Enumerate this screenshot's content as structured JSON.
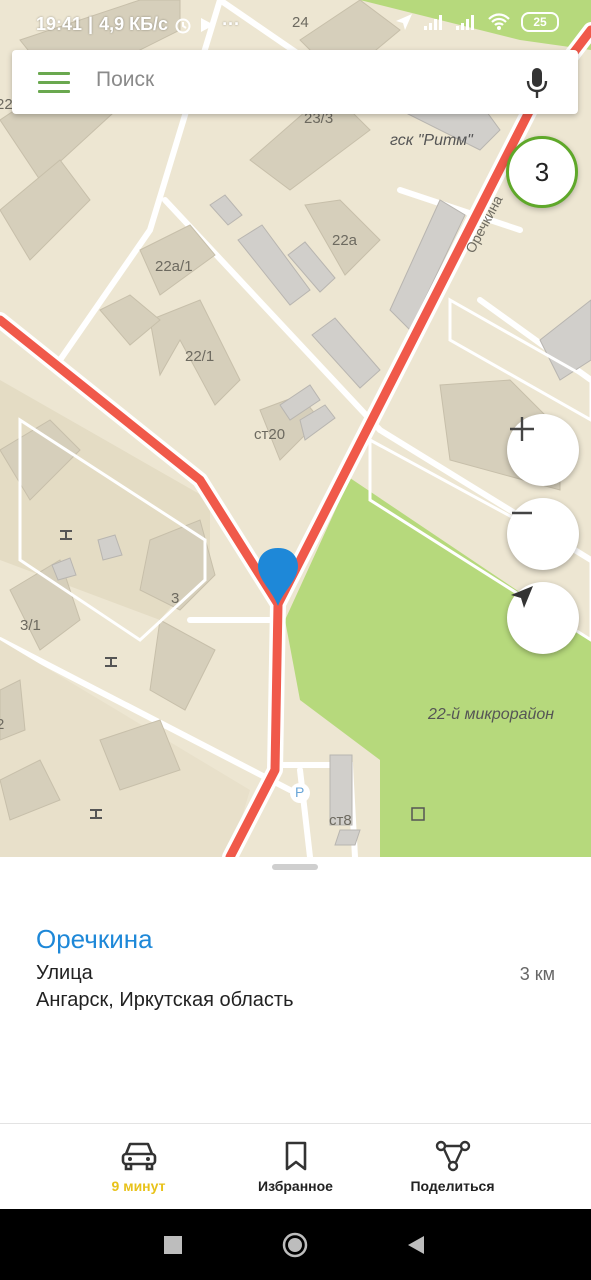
{
  "status_bar": {
    "time": "19:41",
    "speed": "4,9 КБ/с",
    "dots": "···",
    "battery": "25"
  },
  "search": {
    "placeholder": "Поиск",
    "menu_icon": "hamburger-icon",
    "mic_icon": "microphone-icon"
  },
  "map": {
    "traffic_level": "3",
    "labels": {
      "b24": "24",
      "b23_3": "23/3",
      "garage": "гск \"Ритм\"",
      "street": "Оречкина",
      "b22a": "22а",
      "b22a1": "22а/1",
      "b22_1": "22/1",
      "st20": "ст20",
      "b3": "3",
      "b3_1": "3/1",
      "district": "22-й микрорайон",
      "st8": "ст8",
      "parking": "P",
      "edge_left_top": "22",
      "edge_left_mid": "2"
    },
    "controls": {
      "zoom_in": "+",
      "zoom_out": "−"
    }
  },
  "place": {
    "name": "Оречкина",
    "type": "Улица",
    "address": "Ангарск, Иркутская область",
    "distance": "3 км"
  },
  "actions": {
    "route": "9 минут",
    "favorite": "Избранное",
    "share": "Поделиться"
  },
  "colors": {
    "road": "#f0594a",
    "park": "#b6d97c",
    "accent": "#1e88d8",
    "route_label": "#e8c21a",
    "traffic_ring": "#5fa82a"
  }
}
